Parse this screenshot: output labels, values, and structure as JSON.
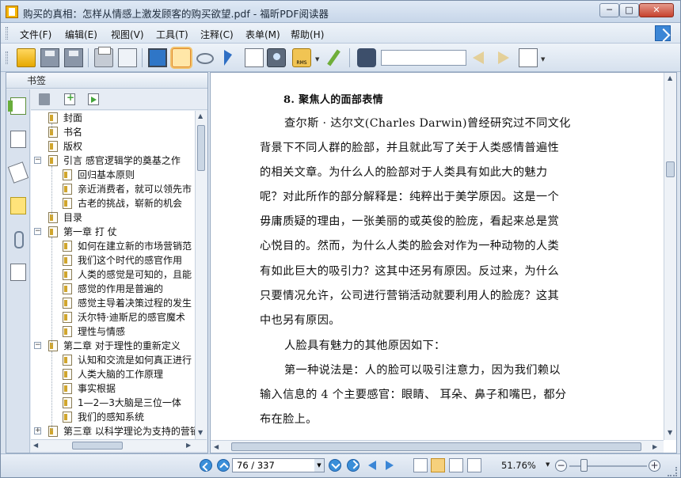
{
  "window": {
    "title": "购买的真相：怎样从情感上激发顾客的购买欲望.pdf - 福昕PDF阅读器",
    "minimize_label": "─",
    "maximize_label": "□",
    "close_label": "✕"
  },
  "menu": {
    "items": [
      {
        "label": "文件(F)"
      },
      {
        "label": "编辑(E)"
      },
      {
        "label": "视图(V)"
      },
      {
        "label": "工具(T)"
      },
      {
        "label": "注释(C)"
      },
      {
        "label": "表单(M)"
      },
      {
        "label": "帮助(H)"
      }
    ]
  },
  "toolbar": {
    "icons": [
      "open-folder-icon",
      "save-icon",
      "save-all-icon",
      "print-icon",
      "properties-icon",
      "fullscreen-icon",
      "hand-tool-icon",
      "loupe-icon",
      "select-arrow-icon",
      "text-select-icon",
      "snapshot-camera-icon",
      "rms-lock-icon",
      "sign-pen-icon",
      "binoculars-search-icon",
      "find-prev-icon",
      "find-next-icon",
      "sheet-select-icon"
    ],
    "active_tool": "hand-tool-icon",
    "rms_label": "RMS",
    "search_value": ""
  },
  "sidebar": {
    "title": "书签",
    "tabs": [
      "bookmarks-tab-icon",
      "pages-tab-icon",
      "layers-tab-icon",
      "comments-tab-icon",
      "attachments-tab-icon",
      "signatures-tab-icon"
    ],
    "bookmarks": [
      {
        "label": "封面",
        "level": 1
      },
      {
        "label": "书名",
        "level": 1
      },
      {
        "label": "版权",
        "level": 1
      },
      {
        "label": "引言 感官逻辑学的奠基之作",
        "level": 1,
        "expanded": true
      },
      {
        "label": "回归基本原则",
        "level": 2
      },
      {
        "label": "亲近消费者，就可以领先市",
        "level": 2
      },
      {
        "label": "古老的挑战，崭新的机会",
        "level": 2
      },
      {
        "label": "目录",
        "level": 1
      },
      {
        "label": "第一章 打 仗",
        "level": 1,
        "expanded": true
      },
      {
        "label": "如何在建立新的市场营销范",
        "level": 2
      },
      {
        "label": "我们这个时代的感官作用",
        "level": 2
      },
      {
        "label": "人类的感觉是可知的，且能",
        "level": 2
      },
      {
        "label": "感觉的作用是普遍的",
        "level": 2
      },
      {
        "label": "感觉主导着决策过程的发生",
        "level": 2
      },
      {
        "label": "沃尔特·迪斯尼的感官魔术",
        "level": 2
      },
      {
        "label": "理性与情感",
        "level": 2
      },
      {
        "label": "第二章 对于理性的重新定义",
        "level": 1,
        "expanded": true
      },
      {
        "label": "认知和交流是如何真正进行",
        "level": 2
      },
      {
        "label": "人类大脑的工作原理",
        "level": 2
      },
      {
        "label": "事实根据",
        "level": 2
      },
      {
        "label": "1—2—3大脑是三位一体",
        "level": 2
      },
      {
        "label": "我们的感知系统",
        "level": 2
      },
      {
        "label": "第三章 以科学理论为支持的营销",
        "level": 1,
        "expanded": false
      }
    ]
  },
  "document": {
    "heading": "8.  聚焦人的面部表情",
    "lines": [
      "查尔斯 · 达尔文(Charles  Darwin)曾经研究过不同文化",
      "背景下不同人群的脸部，并且就此写了关于人类感情普遍性",
      "的相关文章。为什么人的脸部对于人类具有如此大的魅力",
      "呢？对此所作的部分解释是：纯粹出于美学原因。这是一个",
      "毋庸质疑的理由，一张美丽的或英俊的脸庞，看起来总是赏",
      "心悦目的。然而，为什么人类的脸会对作为一种动物的人类",
      "有如此巨大的吸引力？这其中还另有原因。反过来，为什么",
      "只要情况允许，公司进行营销活动就要利用人的脸庞？这其",
      "中也另有原因。",
      "人脸具有魅力的其他原因如下：",
      "第一种说法是：人的脸可以吸引注意力，因为我们赖以",
      "输入信息的 4 个主要感官：眼睛、 耳朵、鼻子和嘴巴，都分",
      "布在脸上。"
    ]
  },
  "statusbar": {
    "page_display": "76 / 337",
    "current_page": 76,
    "total_pages": 337,
    "zoom": "51.76%",
    "zoom_slider_fraction": 0.18,
    "minus_label": "−",
    "plus_label": "+"
  }
}
